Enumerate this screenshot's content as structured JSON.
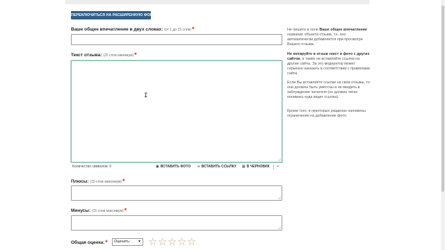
{
  "switch_button": "ПЕРЕКЛЮЧИТЬСЯ НА РАСШИРЕННУЮ ФОРМУ",
  "impression": {
    "label": "Ваше общее впечатление в двух словах:",
    "hint": "(от 1 до 15 слов)"
  },
  "review_text": {
    "label": "Текст отзыва:",
    "hint": "(20 слов минимум)",
    "cursor": "I"
  },
  "toolbar": {
    "char_count": "Количество символов: 0",
    "insert_photo": "ВСТАВИТЬ ФОТО",
    "insert_link": "ВСТАВИТЬ ССЫЛКУ",
    "to_draft": "В ЧЕРНОВИК",
    "more": "⌄"
  },
  "pros": {
    "label": "Плюсы:",
    "hint": "(15 слов максимум)"
  },
  "cons": {
    "label": "Минусы:",
    "hint": "(15 слов максимум)"
  },
  "rating": {
    "label": "Общая оценка:",
    "select_value": "Оценить:",
    "stars": [
      "☆",
      "☆",
      "☆",
      "☆",
      "☆"
    ]
  },
  "required_mark": "*",
  "sidebar": {
    "p1_pre": "Не пишите в поле ",
    "p1_bold": "Ваше общее впечатление",
    "p1_post": " название объекта отзыва, т.к. оно автоматически добавляется при просмотре Вашего отзыва.",
    "p2_bold": "Не копируйте в отзыв текст и фото с других сайтов",
    "p2_post": ", а также не вставляйте ссылки на другие сайты. За это модератор может серьезно наказать в соответствии с правилами сайта.",
    "p3": "Если Вы вставляете ссылки на свои отзывы, то они должны быть уместны и не вводить в заблуждение читателя (он должен четко понимать куда ведет ссылка).",
    "p4": "Кроме того, в некоторых разделах наложены ограничения на добавление фото."
  }
}
